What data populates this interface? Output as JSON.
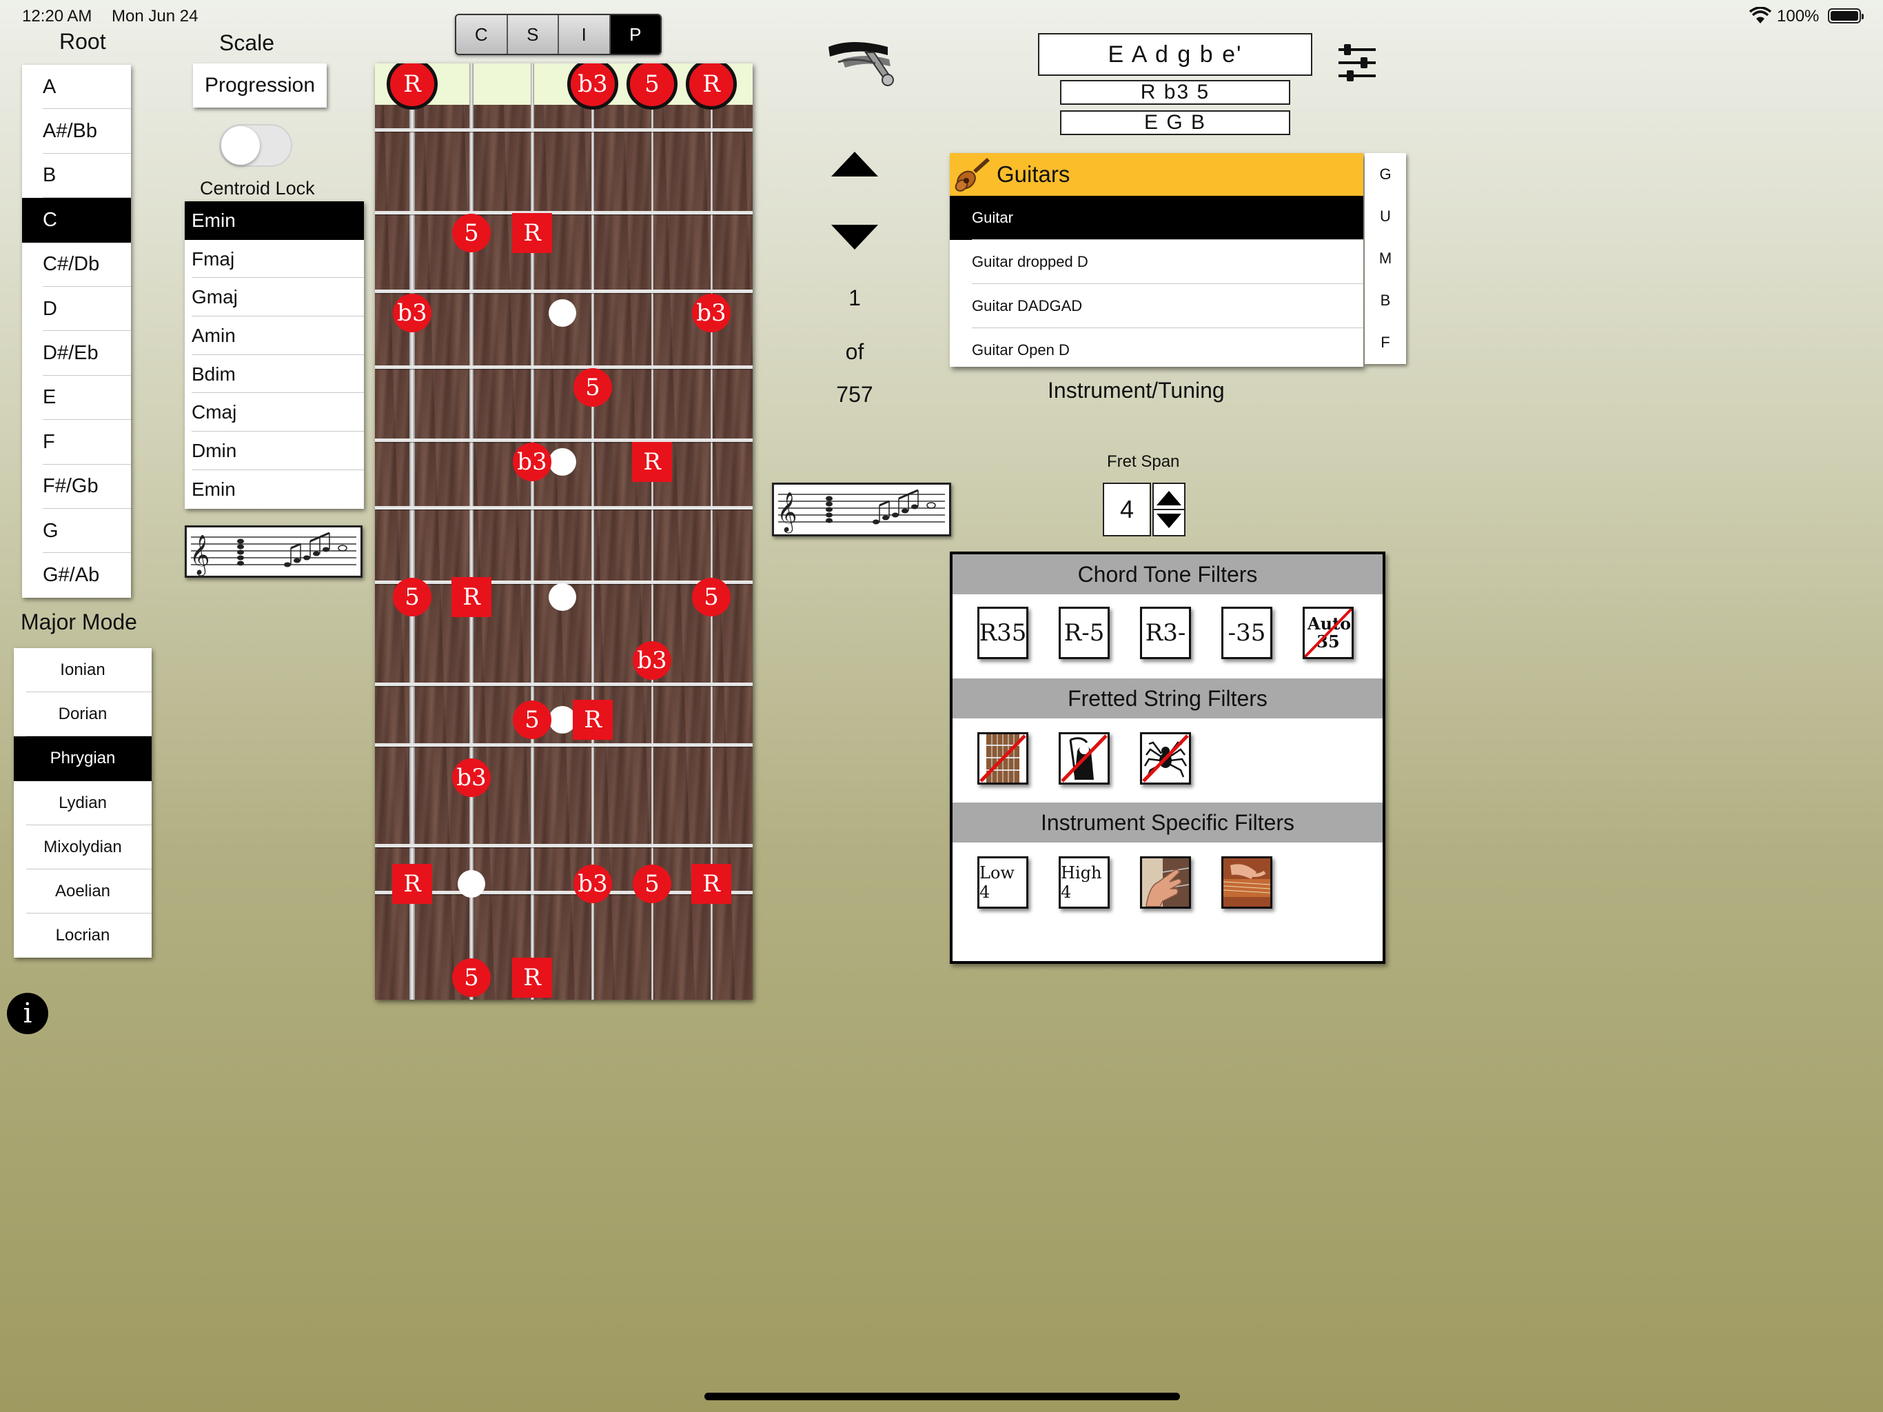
{
  "status": {
    "time": "12:20 AM",
    "date": "Mon Jun 24",
    "battery": "100%"
  },
  "headings": {
    "root": "Root",
    "scale": "Scale",
    "centroid": "Centroid Lock",
    "mode": "Major Mode",
    "instrument": "Instrument/Tuning",
    "fret_span": "Fret Span"
  },
  "root_list": [
    "A",
    "A#/Bb",
    "B",
    "C",
    "C#/Db",
    "D",
    "D#/Eb",
    "E",
    "F",
    "F#/Gb",
    "G",
    "G#/Ab"
  ],
  "root_selected": "C",
  "scale_button": "Progression",
  "centroid_lock": false,
  "chord_list": [
    "Emin",
    "Fmaj",
    "Gmaj",
    "Amin",
    "Bdim",
    "Cmaj",
    "Dmin",
    "Emin"
  ],
  "chord_selected": "Emin",
  "modes": [
    "Ionian",
    "Dorian",
    "Phrygian",
    "Lydian",
    "Mixolydian",
    "Aoelian",
    "Locrian"
  ],
  "mode_selected": "Phrygian",
  "view_segments": [
    "C",
    "S",
    "I",
    "P"
  ],
  "view_selected": "P",
  "counter": {
    "current": "1",
    "of": "of",
    "total": "757"
  },
  "tuning": {
    "strings": "E A d g b e'",
    "formula": "R b3 5",
    "notes": "E G B"
  },
  "instrument": {
    "group": "Guitars",
    "items": [
      "Guitar",
      "Guitar dropped D",
      "Guitar DADGAD",
      "Guitar Open D"
    ],
    "selected": "Guitar",
    "index": [
      "G",
      "U",
      "M",
      "B",
      "F"
    ]
  },
  "fret_span": "4",
  "filters": {
    "chord_tone_title": "Chord Tone Filters",
    "chord_tone_buttons": [
      "R35",
      "R-5",
      "R3-",
      "-35",
      "Auto 35"
    ],
    "fretted_title": "Fretted String Filters",
    "instrument_title": "Instrument Specific Filters",
    "instrument_buttons": [
      "Low 4",
      "High 4"
    ]
  },
  "fretboard_notes": [
    {
      "label": "R",
      "string": 0,
      "fret": 0,
      "shape": "circle"
    },
    {
      "label": "b3",
      "string": 3,
      "fret": 0,
      "shape": "circle"
    },
    {
      "label": "5",
      "string": 4,
      "fret": 0,
      "shape": "circle"
    },
    {
      "label": "R",
      "string": 5,
      "fret": 0,
      "shape": "circle"
    },
    {
      "label": "5",
      "string": 1,
      "fret": 1,
      "shape": "circle"
    },
    {
      "label": "R",
      "string": 2,
      "fret": 1,
      "shape": "square"
    },
    {
      "label": "b3",
      "string": 0,
      "fret": 2,
      "shape": "circle"
    },
    {
      "label": "b3",
      "string": 5,
      "fret": 2,
      "shape": "circle"
    },
    {
      "label": "5",
      "string": 3,
      "fret": 3,
      "shape": "circle"
    },
    {
      "label": "b3",
      "string": 2,
      "fret": 4,
      "shape": "circle"
    },
    {
      "label": "R",
      "string": 4,
      "fret": 4,
      "shape": "square"
    },
    {
      "label": "5",
      "string": 0,
      "fret": 5,
      "shape": "circle"
    },
    {
      "label": "R",
      "string": 1,
      "fret": 5,
      "shape": "square"
    },
    {
      "label": "5",
      "string": 5,
      "fret": 5,
      "shape": "circle"
    },
    {
      "label": "b3",
      "string": 4,
      "fret": 6,
      "shape": "circle"
    },
    {
      "label": "5",
      "string": 2,
      "fret": 7,
      "shape": "circle"
    },
    {
      "label": "R",
      "string": 3,
      "fret": 7,
      "shape": "square"
    },
    {
      "label": "b3",
      "string": 1,
      "fret": 8,
      "shape": "circle"
    },
    {
      "label": "R",
      "string": 0,
      "fret": 9,
      "shape": "square"
    },
    {
      "label": "b3",
      "string": 3,
      "fret": 9,
      "shape": "circle"
    },
    {
      "label": "5",
      "string": 4,
      "fret": 9,
      "shape": "circle"
    },
    {
      "label": "R",
      "string": 5,
      "fret": 9,
      "shape": "square"
    },
    {
      "label": "5",
      "string": 1,
      "fret": 10,
      "shape": "circle"
    },
    {
      "label": "R",
      "string": 2,
      "fret": 10,
      "shape": "square"
    }
  ],
  "fretboard_inlays": [
    {
      "fret": 2,
      "between": [
        2,
        3
      ]
    },
    {
      "fret": 4,
      "between": [
        2,
        3
      ]
    },
    {
      "fret": 5,
      "between": [
        2,
        3
      ]
    },
    {
      "fret": 7,
      "between": [
        2,
        3
      ]
    },
    {
      "fret": 9,
      "between": [
        1,
        1
      ]
    }
  ]
}
